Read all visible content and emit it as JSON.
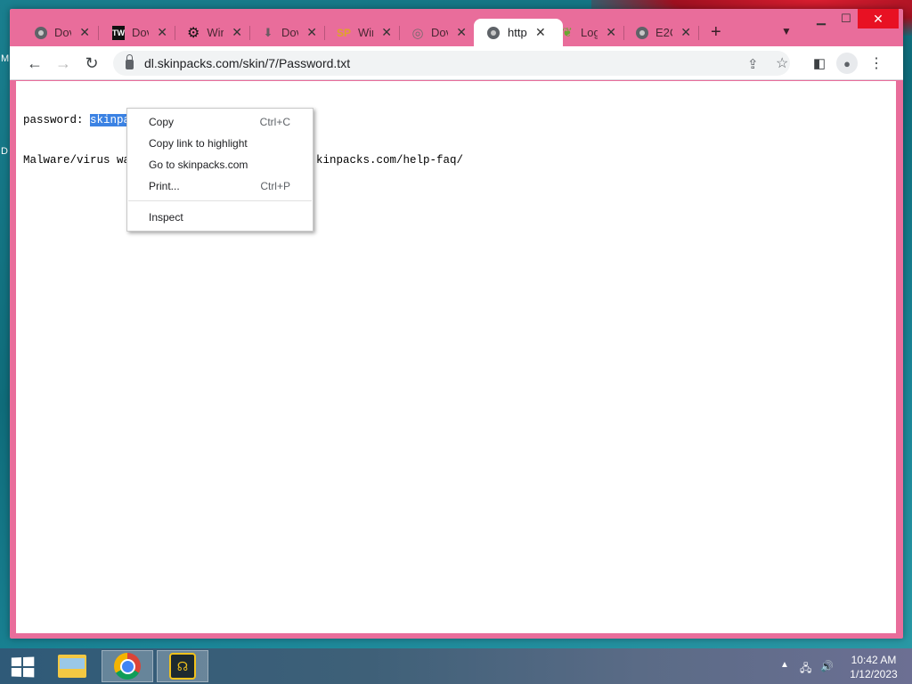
{
  "desktop": {
    "letters": [
      "M",
      "D"
    ]
  },
  "browser": {
    "tabs": [
      {
        "label": "Dov",
        "icon": "globe-icon"
      },
      {
        "label": "Dov",
        "icon": "tw-logo-icon",
        "favicon_text": "TW"
      },
      {
        "label": "Wir",
        "icon": "gear-icon"
      },
      {
        "label": "Dov",
        "icon": "download-icon"
      },
      {
        "label": "Wir",
        "icon": "sp-logo-icon",
        "favicon_text": "SP"
      },
      {
        "label": "Dov",
        "icon": "swirl-icon"
      },
      {
        "label": "http",
        "icon": "globe-icon",
        "active": true
      },
      {
        "label": "Log",
        "icon": "leaf-icon"
      },
      {
        "label": "E2C",
        "icon": "globe-icon"
      }
    ],
    "new_tab_label": "+",
    "url": "dl.skinpacks.com/skin/7/Password.txt",
    "accent": "#e96d9b"
  },
  "page": {
    "line1_prefix": "password: ",
    "line1_selected": "skinpa",
    "line1_rest": "       ",
    "line2_left": "Malware/virus wa",
    "line2_right": "kinpacks.com/help-faq/"
  },
  "context_menu": {
    "items": [
      {
        "label": "Copy",
        "shortcut": "Ctrl+C"
      },
      {
        "label": "Copy link to highlight",
        "shortcut": ""
      },
      {
        "label": "Go to skinpacks.com",
        "shortcut": ""
      },
      {
        "label": "Print...",
        "shortcut": "Ctrl+P"
      },
      {
        "label": "Inspect",
        "shortcut": ""
      }
    ]
  },
  "taskbar": {
    "time": "10:42 AM",
    "date": "1/12/2023"
  }
}
